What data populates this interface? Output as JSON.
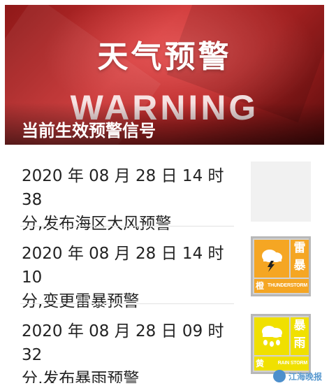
{
  "banner": {
    "title": "天气预警",
    "subtitle": "WARNING",
    "label": "当前生效预警信号"
  },
  "rows": [
    {
      "line1": "2020 年 08 月 28 日 14 时 38",
      "line2": "分,发布海区大风预警",
      "thumb": "empty"
    },
    {
      "line1": "2020 年 08 月 28 日 14 时 10",
      "line2": "分,变更雷暴预警",
      "thumb": "thunderstorm-warning-orange-icon",
      "badge_char1": "雷",
      "badge_char2": "暴",
      "badge_level": "橙",
      "badge_en": "THUNDERSTORM"
    },
    {
      "line1": "2020 年 08 月 28 日 09 时 32",
      "line2": "分,发布暴雨预警",
      "thumb": "rainstorm-warning-yellow-icon",
      "badge_char1": "暴",
      "badge_char2": "雨",
      "badge_level": "黄",
      "badge_en": "RAIN STORM"
    }
  ],
  "footer": {
    "left": "",
    "right": "江海晚报"
  },
  "colors": {
    "banner_red": "#b22424",
    "orange_signal": "#f5a623",
    "yellow_signal": "#f0e000"
  }
}
